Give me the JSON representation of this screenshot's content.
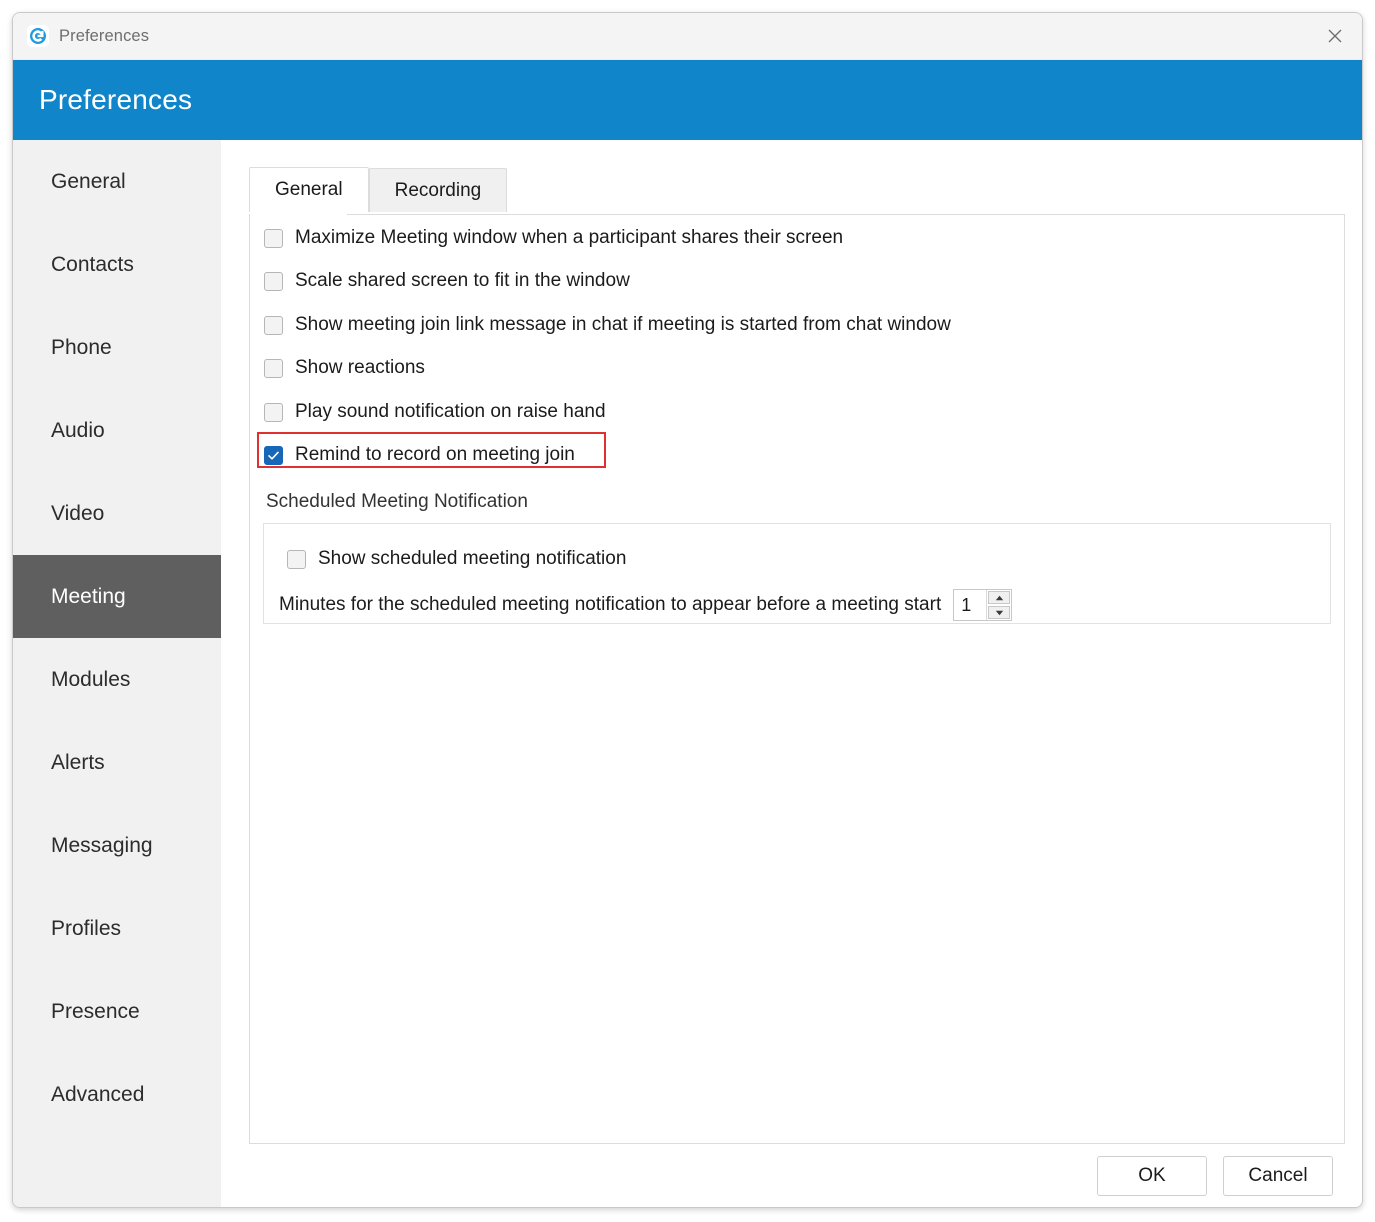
{
  "window": {
    "titlebar_text": "Preferences",
    "app_icon": "goto-logo-icon",
    "close_icon": "close-icon",
    "header_title": "Preferences",
    "header_color": "#1185c9"
  },
  "sidebar": {
    "items": [
      {
        "label": "General",
        "selected": false
      },
      {
        "label": "Contacts",
        "selected": false
      },
      {
        "label": "Phone",
        "selected": false
      },
      {
        "label": "Audio",
        "selected": false
      },
      {
        "label": "Video",
        "selected": false
      },
      {
        "label": "Meeting",
        "selected": true
      },
      {
        "label": "Modules",
        "selected": false
      },
      {
        "label": "Alerts",
        "selected": false
      },
      {
        "label": "Messaging",
        "selected": false
      },
      {
        "label": "Profiles",
        "selected": false
      },
      {
        "label": "Presence",
        "selected": false
      },
      {
        "label": "Advanced",
        "selected": false
      }
    ],
    "selected_color": "#5f5f5f"
  },
  "main": {
    "tabs": [
      {
        "label": "General",
        "active": true
      },
      {
        "label": "Recording",
        "active": false
      }
    ],
    "checkboxes": [
      {
        "label": "Maximize Meeting window when a participant shares their screen",
        "checked": false
      },
      {
        "label": "Scale shared screen to fit in the window",
        "checked": false
      },
      {
        "label": "Show meeting join link message in chat if meeting is started from chat window",
        "checked": false
      },
      {
        "label": "Show reactions",
        "checked": false
      },
      {
        "label": "Play sound notification on raise hand",
        "checked": false
      },
      {
        "label": "Remind to record on meeting join",
        "checked": true
      }
    ],
    "highlight": {
      "target_label": "Remind to record on meeting join",
      "color": "#e03131"
    },
    "section": {
      "heading": "Scheduled Meeting Notification",
      "show_notification": {
        "label": "Show scheduled meeting notification",
        "checked": false
      },
      "minutes": {
        "label": "Minutes for the scheduled meeting notification to appear before a meeting start",
        "value": "1",
        "increment_icon": "caret-up-icon",
        "decrement_icon": "caret-down-icon"
      }
    }
  },
  "footer": {
    "ok_label": "OK",
    "cancel_label": "Cancel"
  }
}
